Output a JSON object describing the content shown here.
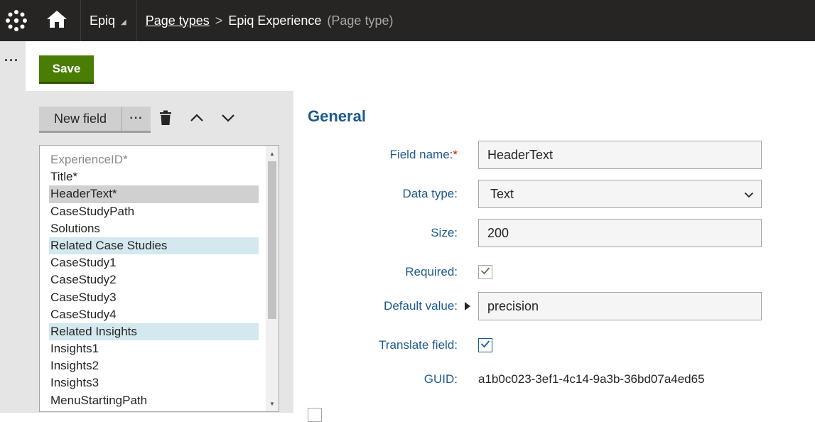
{
  "topbar": {
    "site_name": "Epiq",
    "breadcrumb_link": "Page types",
    "breadcrumb_current": "Epiq Experience",
    "breadcrumb_type": "(Page type)"
  },
  "toolbar": {
    "save_label": "Save"
  },
  "fields_panel": {
    "new_field_label": "New field",
    "items": [
      {
        "label": "ExperienceID*",
        "state": "disabled"
      },
      {
        "label": "Title*",
        "state": "normal"
      },
      {
        "label": "HeaderText*",
        "state": "selected"
      },
      {
        "label": "CaseStudyPath",
        "state": "normal"
      },
      {
        "label": "Solutions",
        "state": "normal"
      },
      {
        "label": "Related Case Studies",
        "state": "category"
      },
      {
        "label": "CaseStudy1",
        "state": "normal"
      },
      {
        "label": "CaseStudy2",
        "state": "normal"
      },
      {
        "label": "CaseStudy3",
        "state": "normal"
      },
      {
        "label": "CaseStudy4",
        "state": "normal"
      },
      {
        "label": "Related Insights",
        "state": "category"
      },
      {
        "label": "Insights1",
        "state": "normal"
      },
      {
        "label": "Insights2",
        "state": "normal"
      },
      {
        "label": "Insights3",
        "state": "normal"
      },
      {
        "label": "MenuStartingPath",
        "state": "normal"
      }
    ]
  },
  "form": {
    "section_title": "General",
    "field_name_label": "Field name:",
    "field_name_required": "*",
    "field_name_value": "HeaderText",
    "data_type_label": "Data type:",
    "data_type_value": "Text",
    "size_label": "Size:",
    "size_value": "200",
    "required_label": "Required:",
    "required_checked": true,
    "default_value_label": "Default value:",
    "default_value_value": "precision",
    "translate_label": "Translate field:",
    "translate_checked": true,
    "guid_label": "GUID:",
    "guid_value": "a1b0c023-3ef1-4c14-9a3b-36bd07a4ed65"
  },
  "colors": {
    "topbar": "#262524",
    "save_button": "#497d04",
    "label_blue": "#1e5a8c",
    "category_highlight": "#d4e8ef",
    "selected_highlight": "#d0d0d0"
  },
  "icons": [
    "kentico-logo-icon",
    "home-icon",
    "more-dots-icon",
    "trash-icon",
    "chevron-up-icon",
    "chevron-down-icon",
    "check-icon",
    "expand-triangle-icon"
  ]
}
